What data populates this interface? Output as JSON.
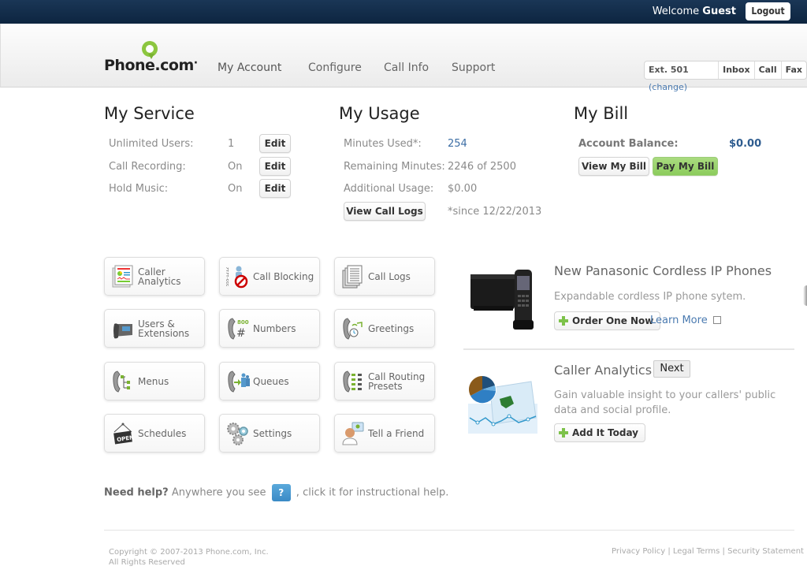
{
  "topbar": {
    "welcome_prefix": "Welcome",
    "user_name": "Guest",
    "logout_label": "Logout"
  },
  "header": {
    "logo_text": "Phone.com",
    "logo_mark": "·",
    "nav": [
      {
        "label": "My Account",
        "active": true
      },
      {
        "label": "Configure"
      },
      {
        "label": "Call Info"
      },
      {
        "label": "Support"
      }
    ],
    "ext_bar": {
      "extension": "Ext. 501",
      "change_label": "(change)",
      "inbox_label": "Inbox",
      "call_label": "Call",
      "fax_label": "Fax"
    }
  },
  "my_service": {
    "title": "My Service",
    "rows": [
      {
        "label": "Unlimited Users:",
        "value": "1",
        "button": "Edit"
      },
      {
        "label": "Call Recording:",
        "value": "On",
        "button": "Edit"
      },
      {
        "label": "Hold Music:",
        "value": "On",
        "button": "Edit"
      }
    ]
  },
  "my_usage": {
    "title": "My Usage",
    "rows": [
      {
        "label": "Minutes Used*:",
        "value": "254"
      },
      {
        "label": "Remaining Minutes:",
        "value": "2246 of 2500"
      },
      {
        "label": "Additional Usage:",
        "value": "$0.00"
      }
    ],
    "view_logs_label": "View Call Logs",
    "since_note": "*since 12/22/2013"
  },
  "my_bill": {
    "title": "My Bill",
    "balance_label": "Account Balance:",
    "balance_value": "$0.00",
    "view_bill_label": "View My Bill",
    "pay_bill_label": "Pay My Bill"
  },
  "tiles": [
    {
      "label": "Caller Analytics",
      "icon": "caller-analytics-icon"
    },
    {
      "label": "Call Blocking",
      "icon": "call-blocking-icon"
    },
    {
      "label": "Call Logs",
      "icon": "call-logs-icon"
    },
    {
      "label": "Users & Extensions",
      "icon": "desk-phone-icon"
    },
    {
      "label": "Numbers",
      "icon": "numbers-icon"
    },
    {
      "label": "Greetings",
      "icon": "greetings-icon"
    },
    {
      "label": "Menus",
      "icon": "menus-icon"
    },
    {
      "label": "Queues",
      "icon": "queues-icon"
    },
    {
      "label": "Call Routing Presets",
      "icon": "call-routing-icon"
    },
    {
      "label": "Schedules",
      "icon": "open-sign-icon"
    },
    {
      "label": "Settings",
      "icon": "gears-icon"
    },
    {
      "label": "Tell a Friend",
      "icon": "tell-friend-icon"
    }
  ],
  "promos": [
    {
      "title": "New Panasonic Cordless IP Phones",
      "description": "Expandable cordless IP phone sytem.",
      "button_label": "Order One Now",
      "link_label": "Learn More"
    },
    {
      "title": "Caller Analytics",
      "next_label": "Next",
      "description": "Gain valuable insight to your callers' public data and social profile.",
      "button_label": "Add It Today"
    }
  ],
  "help": {
    "bold": "Need help?",
    "text_before": " Anywhere you see ",
    "icon_text": "?",
    "text_after": " , click it for instructional help."
  },
  "footer": {
    "copyright_line1": "Copyright © 2007-2013 Phone.com, Inc.",
    "copyright_line2": "All Rights Reserved",
    "links": [
      "Privacy Policy",
      "Legal Terms",
      "Security Statement"
    ],
    "separator": "|"
  },
  "colors": {
    "topbar": "#0d2540",
    "brand_green": "#8cc63f",
    "link_blue": "#4a7ab0",
    "help_blue": "#3a8ac6"
  }
}
